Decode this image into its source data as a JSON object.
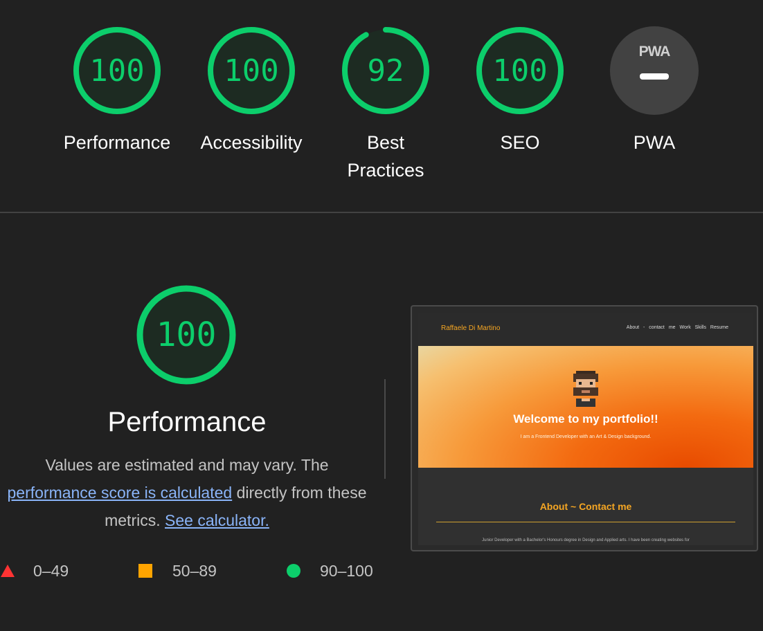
{
  "categories": [
    {
      "label": "Performance",
      "score": 100,
      "score_text": "100"
    },
    {
      "label": "Accessibility",
      "score": 100,
      "score_text": "100"
    },
    {
      "label_line1": "Best",
      "label_line2": "Practices",
      "score": 92,
      "score_text": "92"
    },
    {
      "label": "SEO",
      "score": 100,
      "score_text": "100"
    },
    {
      "label": "PWA",
      "badge_text": "PWA"
    }
  ],
  "performance": {
    "score": 100,
    "score_text": "100",
    "title": "Performance",
    "desc_part1": "Values are estimated and may vary. The ",
    "link1": "performance score is calculated",
    "desc_part2": " directly from these metrics. ",
    "link2": "See calculator."
  },
  "legend": [
    {
      "range": "0–49",
      "color": "#ff3333"
    },
    {
      "range": "50–89",
      "color": "#ffa400"
    },
    {
      "range": "90–100",
      "color": "#0cce6b"
    }
  ],
  "screenshot": {
    "brand": "Raffaele Di Martino",
    "nav": "About - contact me  Work  Skills  Resume",
    "welcome": "Welcome to my portfolio!!",
    "subtitle": "I am a Frontend Developer with an Art & Design background.",
    "about_heading": "About ~ Contact me",
    "paragraph": "Junior Developer with a Bachelor's Honours degree in Design and Applied arts. I have been creating websites for"
  },
  "colors": {
    "pass": "#0cce6b",
    "gauge_bg": "#1d2b22"
  }
}
